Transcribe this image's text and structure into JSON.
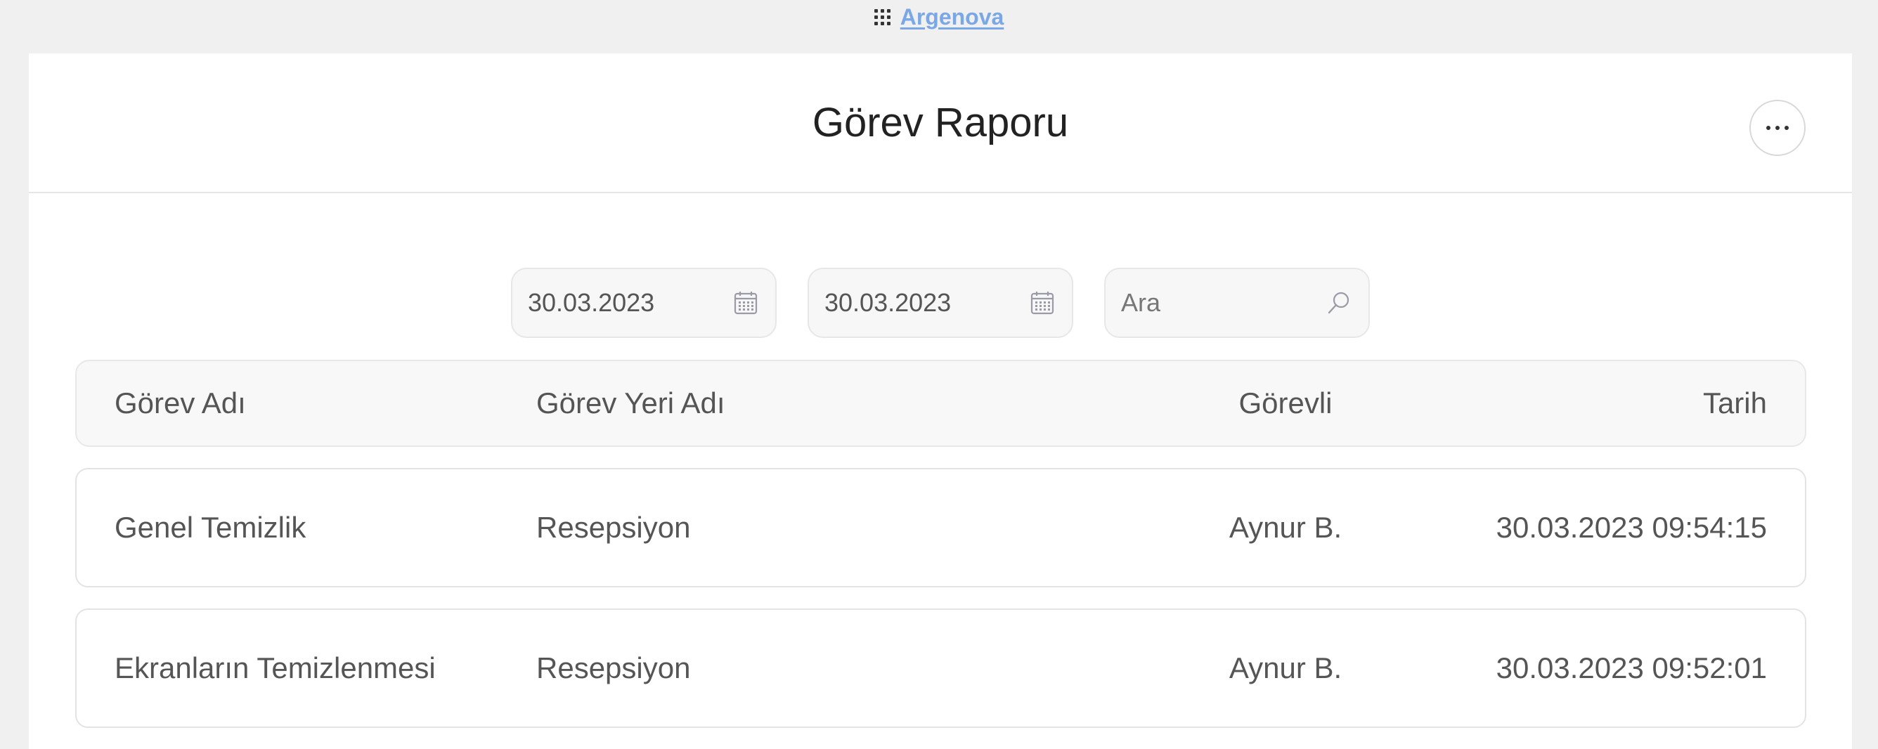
{
  "topbar": {
    "brand": "Argenova",
    "apps_icon": "grid-icon"
  },
  "header": {
    "title": "Görev Raporu",
    "more_icon": "ellipsis-icon"
  },
  "filters": {
    "start_date": "30.03.2023",
    "end_date": "30.03.2023",
    "search_placeholder": "Ara",
    "date_icon": "calendar-icon",
    "search_icon": "search-icon"
  },
  "table": {
    "columns": [
      "Görev Adı",
      "Görev Yeri Adı",
      "Görevli",
      "Tarih"
    ],
    "rows": [
      [
        "Genel Temizlik",
        "Resepsiyon",
        "Aynur B.",
        "30.03.2023 09:54:15"
      ],
      [
        "Ekranların Temizlenmesi",
        "Resepsiyon",
        "Aynur B.",
        "30.03.2023 09:52:01"
      ]
    ]
  },
  "colors": {
    "brand_link": "#7aa7e6",
    "background": "#f0f0f0",
    "card": "#ffffff"
  }
}
